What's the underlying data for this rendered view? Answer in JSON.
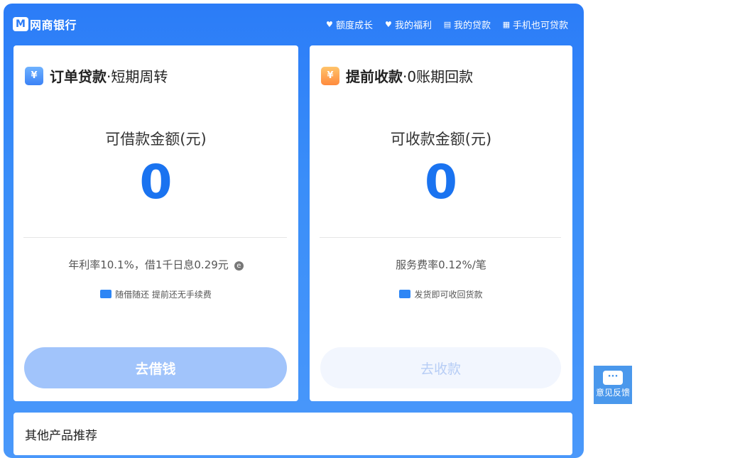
{
  "header": {
    "logo_mark": "M",
    "logo_text": "网商银行",
    "nav": [
      {
        "icon": "heart-icon",
        "glyph": "♥",
        "label": "额度成长"
      },
      {
        "icon": "heart-icon",
        "glyph": "♥",
        "label": "我的福利"
      },
      {
        "icon": "document-icon",
        "glyph": "▤",
        "label": "我的贷款"
      },
      {
        "icon": "qrcode-icon",
        "glyph": "▦",
        "label": "手机也可贷款"
      }
    ]
  },
  "left_card": {
    "title_strong": "订单贷款",
    "title_rest": "·短期周转",
    "icon_glyph": "¥",
    "amount_label": "可借款金额(元)",
    "amount": "0",
    "rate": "年利率10.1%，借1千日息0.29元",
    "rate_info_glyph": "e",
    "hint": "随借随还 提前还无手续费",
    "button": "去借钱"
  },
  "right_card": {
    "title_strong": "提前收款",
    "title_rest": "·0账期回款",
    "icon_glyph": "¥",
    "amount_label": "可收款金额(元)",
    "amount": "0",
    "rate": "服务费率0.12%/笔",
    "hint": "发货即可收回货款",
    "button": "去收款"
  },
  "other": {
    "title": "其他产品推荐"
  },
  "feedback": {
    "label": "意见反馈",
    "glyph": "···"
  },
  "colors": {
    "brand_blue": "#2b7cf7",
    "amount_blue": "#1a73f0",
    "button_primary_disabled": "#a1c4fb",
    "button_secondary_disabled": "#f2f6fe",
    "feedback_bg": "#4a98ec"
  }
}
